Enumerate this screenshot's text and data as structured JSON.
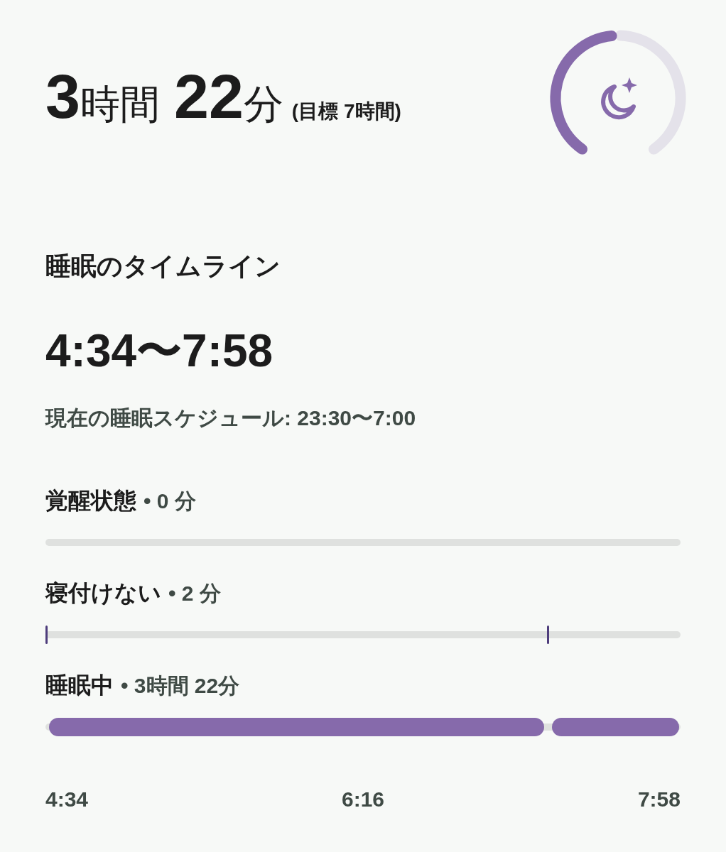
{
  "headline": {
    "parts": [
      {
        "kind": "number",
        "text": "3"
      },
      {
        "kind": "unit",
        "text": "時間"
      },
      {
        "kind": "number",
        "text": "22"
      },
      {
        "kind": "unit",
        "text": "分"
      }
    ],
    "goal": "(目標 7時間)"
  },
  "timeline": {
    "title": "睡眠のタイムライン",
    "range": "4:34〜7:58",
    "schedule": "現在の睡眠スケジュール: 23:30〜7:00",
    "stages": [
      {
        "name": "覚醒状態",
        "duration": "• 0 分"
      },
      {
        "name": "寝付けない",
        "duration": "• 2 分"
      },
      {
        "name": "睡眠中",
        "duration": "• 3時間 22分"
      }
    ],
    "axis": [
      "4:34",
      "6:16",
      "7:58"
    ]
  }
}
